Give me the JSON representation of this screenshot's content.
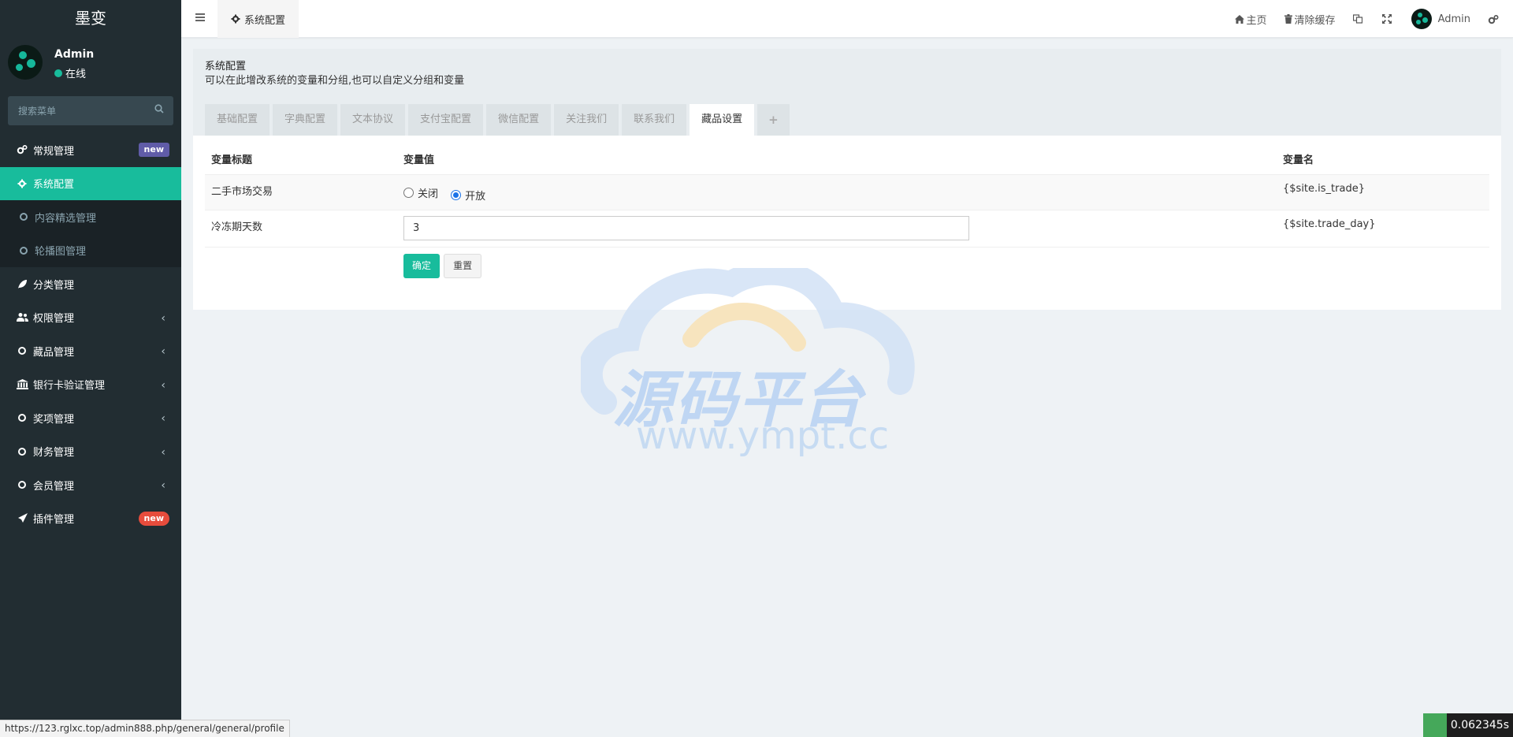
{
  "app": {
    "brand": "墨变"
  },
  "user": {
    "name": "Admin",
    "status": "在线"
  },
  "search": {
    "placeholder": "搜索菜单"
  },
  "sidebar": {
    "items": [
      {
        "label": "常规管理",
        "badge": "new",
        "icon": "cogs-icon"
      },
      {
        "label": "系统配置",
        "icon": "gear-icon"
      },
      {
        "label": "内容精选管理",
        "icon": "circle-icon"
      },
      {
        "label": "轮播图管理",
        "icon": "circle-icon"
      },
      {
        "label": "分类管理",
        "icon": "leaf-icon"
      },
      {
        "label": "权限管理",
        "icon": "users-icon"
      },
      {
        "label": "藏品管理",
        "icon": "circle-icon"
      },
      {
        "label": "银行卡验证管理",
        "icon": "bank-icon"
      },
      {
        "label": "奖项管理",
        "icon": "circle-icon"
      },
      {
        "label": "财务管理",
        "icon": "circle-icon"
      },
      {
        "label": "会员管理",
        "icon": "circle-icon"
      },
      {
        "label": "插件管理",
        "badge": "new",
        "icon": "rocket-icon"
      }
    ]
  },
  "header": {
    "tab_label": "系统配置",
    "home_label": "主页",
    "clear_cache_label": "清除缓存",
    "admin_label": "Admin"
  },
  "panel": {
    "title": "系统配置",
    "description": "可以在此增改系统的变量和分组,也可以自定义分组和变量",
    "tabs": [
      "基础配置",
      "字典配置",
      "文本协议",
      "支付宝配置",
      "微信配置",
      "关注我们",
      "联系我们",
      "藏品设置"
    ],
    "active_tab": "藏品设置",
    "add_tab": "+"
  },
  "table": {
    "headers": [
      "变量标题",
      "变量值",
      "变量名"
    ],
    "rows": [
      {
        "title": "二手市场交易",
        "options": [
          "关闭",
          "开放"
        ],
        "selected": "开放",
        "var_name": "{$site.is_trade}"
      },
      {
        "title": "冷冻期天数",
        "value": "3",
        "var_name": "{$site.trade_day}"
      }
    ],
    "ok_label": "确定",
    "reset_label": "重置"
  },
  "watermark": {
    "main": "源码平台",
    "url": "www.ympt.cc"
  },
  "statusbar": {
    "url": "https://123.rglxc.top/admin888.php/general/general/profile"
  },
  "timer": {
    "value": "0.062345s"
  },
  "colors": {
    "sidebar_bg": "#222d32",
    "accent": "#18bc9c",
    "badge_purple": "#605ca8",
    "badge_red": "#e74c3c"
  }
}
